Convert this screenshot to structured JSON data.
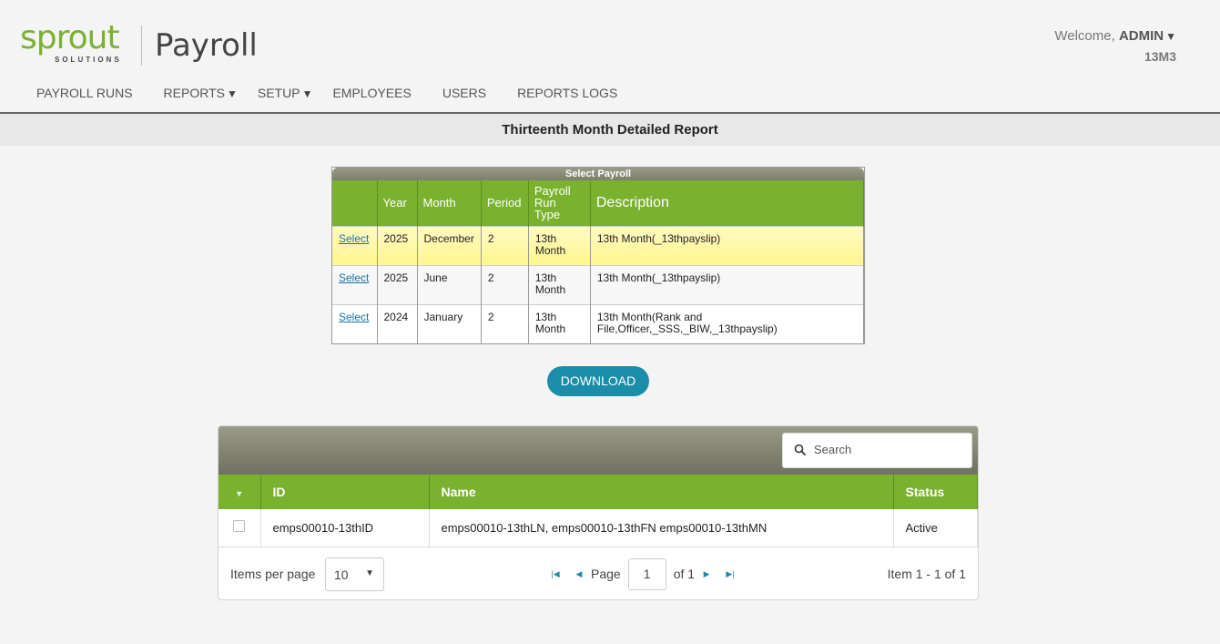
{
  "header": {
    "logo_word": "sprout",
    "logo_sub": "SOLUTIONS",
    "product": "Payroll",
    "welcome_prefix": "Welcome,",
    "user": "ADMIN",
    "company": "13M3"
  },
  "nav": [
    {
      "label": "PAYROLL RUNS",
      "dropdown": false
    },
    {
      "label": "REPORTS",
      "dropdown": true
    },
    {
      "label": "SETUP",
      "dropdown": true
    },
    {
      "label": "EMPLOYEES",
      "dropdown": false
    },
    {
      "label": "USERS",
      "dropdown": false
    },
    {
      "label": "REPORTS LOGS",
      "dropdown": false
    }
  ],
  "page_title": "Thirteenth Month Detailed Report",
  "payroll_grid": {
    "caption": "Select Payroll",
    "headers": {
      "select": "",
      "year": "Year",
      "month": "Month",
      "period": "Period",
      "run_type": "Payroll Run Type",
      "description": "Description"
    },
    "rows": [
      {
        "select": "Select",
        "year": "2025",
        "month": "December",
        "period": "2",
        "run_type": "13th Month",
        "description": "13th Month(_13thpayslip)",
        "highlighted": true
      },
      {
        "select": "Select",
        "year": "2025",
        "month": "June",
        "period": "2",
        "run_type": "13th Month",
        "description": "13th Month(_13thpayslip)",
        "highlighted": false
      },
      {
        "select": "Select",
        "year": "2024",
        "month": "January",
        "period": "2",
        "run_type": "13th Month",
        "description": "13th Month(Rank and File,Officer,_SSS,_BIW,_13thpayslip)",
        "highlighted": false
      }
    ]
  },
  "download_label": "DOWNLOAD",
  "employee_grid": {
    "search_placeholder": "Search",
    "headers": {
      "id": "ID",
      "name": "Name",
      "status": "Status"
    },
    "rows": [
      {
        "id": "emps00010-13thID",
        "name": "emps00010-13thLN, emps00010-13thFN emps00010-13thMN",
        "status": "Active"
      }
    ],
    "pager": {
      "items_per_page_label": "Items per page",
      "items_per_page": "10",
      "page_label": "Page",
      "page": "1",
      "of_label": "of 1",
      "info": "Item 1 - 1 of 1"
    }
  },
  "colors": {
    "brand_green": "#7ab12e",
    "accent_teal": "#1a8ea8",
    "highlight_yellow": "#fff68a"
  }
}
